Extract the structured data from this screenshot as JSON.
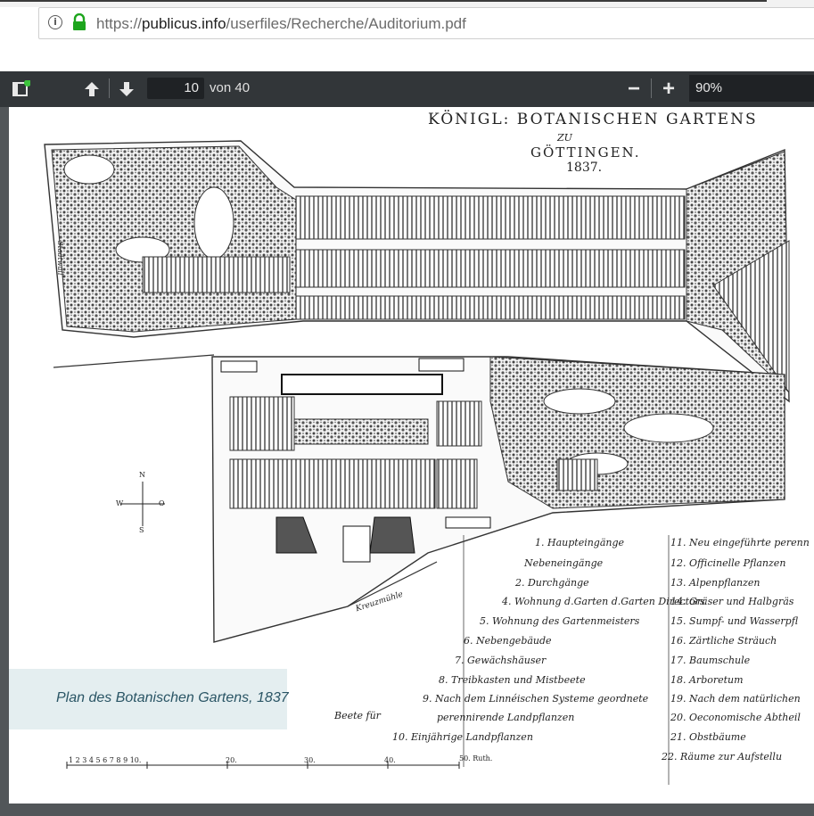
{
  "browser": {
    "url_scheme": "https://",
    "url_host": "publicus.info",
    "url_path": "/userfiles/Recherche/Auditorium.pdf",
    "info_icon": "i"
  },
  "pdf_toolbar": {
    "page_current": "10",
    "page_total_label": "von 40",
    "zoom_minus": "−",
    "zoom_plus": "+",
    "zoom_value": "90%"
  },
  "document": {
    "title_line1": "KÖNIGL: BOTANISCHEN GARTENS",
    "title_line2": "ZU",
    "title_line3": "GÖTTINGEN.",
    "title_line4": "1837.",
    "caption": "Plan des Botanischen Gartens, 1837",
    "compass": {
      "n": "N",
      "s": "S",
      "w": "W",
      "o": "O"
    },
    "legend_left": [
      "1. Haupteingänge",
      "Nebeneingänge",
      "2. Durchgänge",
      "4. Wohnung d.Garten d.Garten Directors",
      "5. Wohnung des Gartenmeisters",
      "6. Nebengebäude",
      "7. Gewächshäuser",
      "8. Treibkasten und Mistbeete",
      "9. Nach dem Linnéischen Systeme geordnete",
      "perennirende Landpflanzen",
      "10. Einjährige Landpflanzen"
    ],
    "legend_beete": "Beete für",
    "legend_right": [
      "11. Neu eingeführte perenn",
      "12. Officinelle Pflanzen",
      "13. Alpenpflanzen",
      "14. Gräser und Halbgräs",
      "15. Sumpf- und Wasserpfl",
      "16. Zärtliche Sträuch",
      "17. Baumschule",
      "18. Arboretum",
      "19. Nach dem natürlichen",
      "20. Oeconomische Abtheil",
      "21. Obstbäume",
      "22. Räume zur Aufstellu"
    ],
    "scale_labels": [
      "1 2 3 4 5 6 7 8 9 10.",
      "20.",
      "30.",
      "40.",
      "50. Ruth."
    ],
    "street_label": "Kreuzmühle",
    "side_label": "Stadtwall"
  },
  "colors": {
    "toolbar": "#323639",
    "viewer_bg": "#525659",
    "caption_bg": "#e4eef0",
    "caption_text": "#2a5565",
    "lock_green": "#1da51d"
  }
}
